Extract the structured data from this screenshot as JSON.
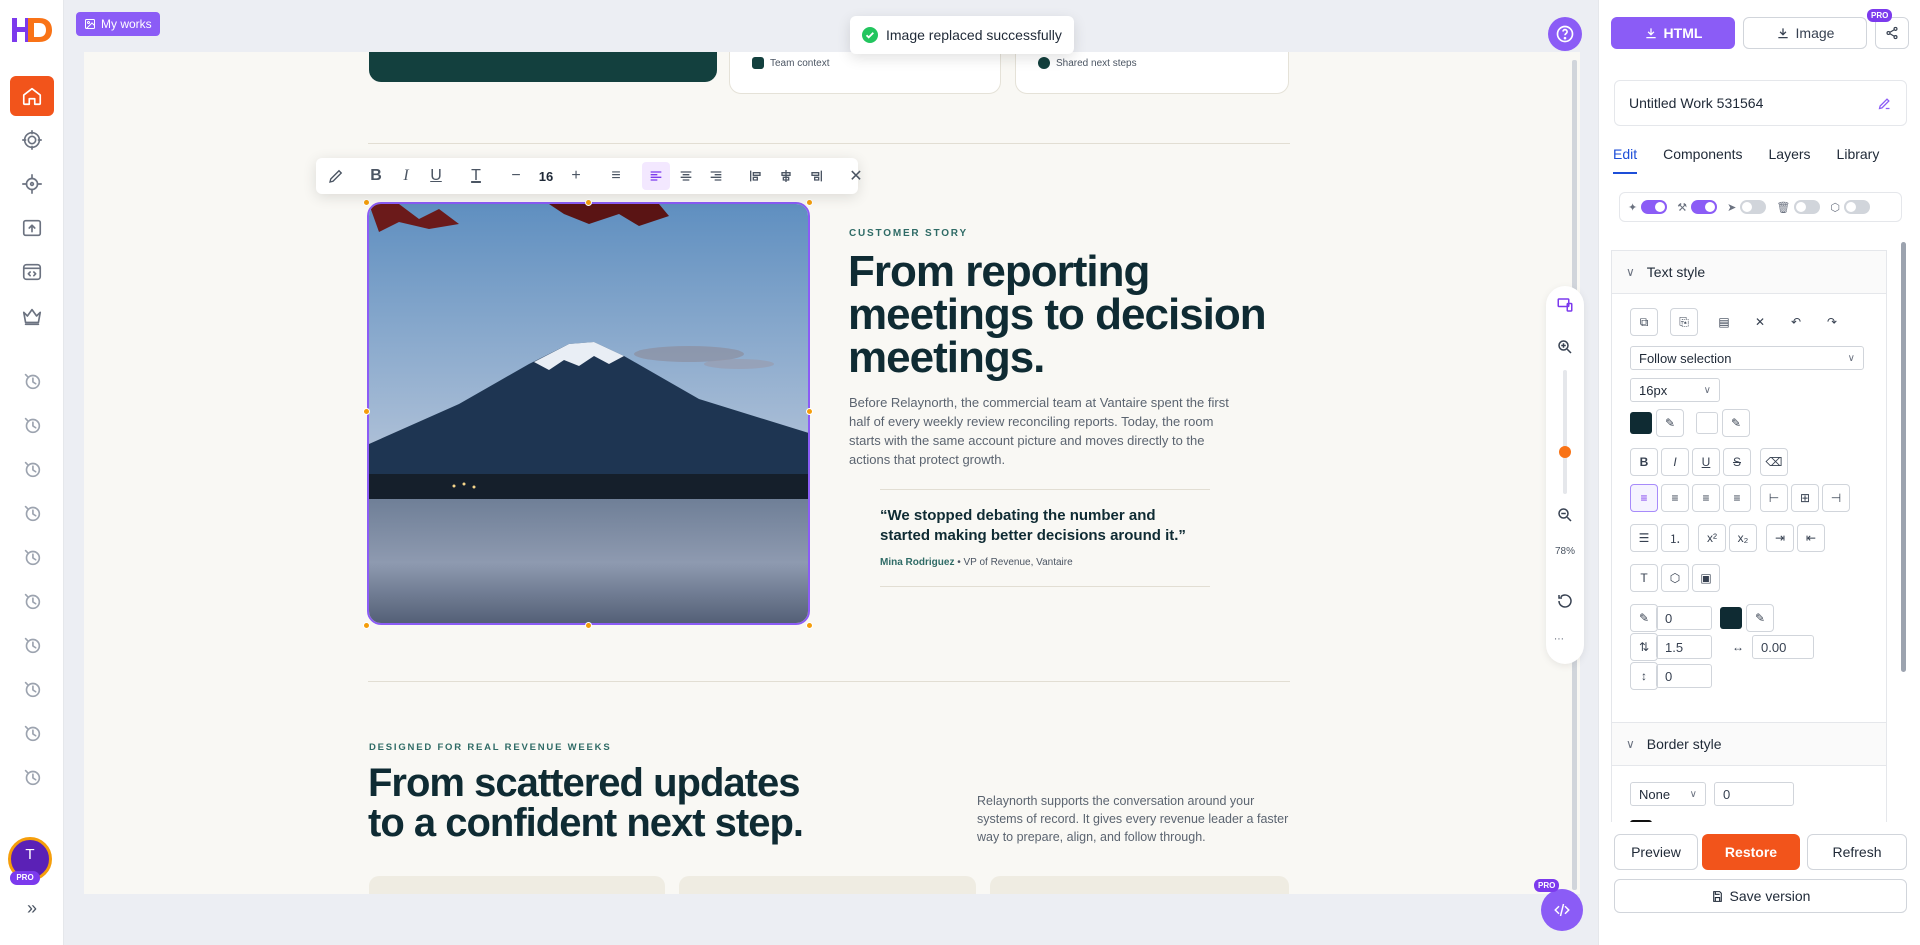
{
  "app": {
    "name": "HD"
  },
  "sidebar": {
    "items": [
      {
        "icon": "home-icon"
      },
      {
        "icon": "target-icon"
      },
      {
        "icon": "crosshair-icon"
      },
      {
        "icon": "upload-icon"
      },
      {
        "icon": "code-window-icon"
      },
      {
        "icon": "crown-icon"
      }
    ],
    "history_icon": "history-icon",
    "history_count": 10,
    "avatar": {
      "initial": "T",
      "badge": "PRO"
    },
    "expand_icon": "»"
  },
  "topbar": {
    "my_works_label": "My works",
    "toast": "Image replaced successfully",
    "help_icon": "help-icon"
  },
  "text_toolbar": {
    "font_size": "16",
    "minus": "−",
    "plus": "+"
  },
  "canvas_content": {
    "top_cards": [
      {
        "text": "Team context"
      },
      {
        "text": "Shared next steps"
      }
    ],
    "story": {
      "eyebrow": "CUSTOMER STORY",
      "title": "From reporting meetings to decision meetings.",
      "body": "Before Relaynorth, the commercial team at Vantaire spent the first half of every weekly review reconciling reports. Today, the room starts with the same account picture and moves directly to the actions that protect growth.",
      "quote": "“We stopped debating the number and started making better decisions around it.”",
      "attribution_name": "Mina Rodriguez",
      "attribution_role": " • VP of Revenue, Vantaire"
    },
    "section2": {
      "eyebrow": "DESIGNED FOR REAL REVENUE WEEKS",
      "title": "From scattered updates to a confident next step.",
      "body": "Relaynorth supports the conversation around your systems of record. It gives every revenue leader a faster way to prepare, align, and follow through."
    }
  },
  "zoom": {
    "level": "78%"
  },
  "right_panel": {
    "export_html": "HTML",
    "export_image": "Image",
    "pro_badge": "PRO",
    "work_title": "Untitled Work 531564",
    "tabs": [
      "Edit",
      "Components",
      "Layers",
      "Library"
    ],
    "active_tab": "Edit",
    "toggles": [
      true,
      true,
      false,
      false,
      false
    ],
    "text_style": {
      "heading": "Text style",
      "font_family": "Follow selection",
      "font_size": "16px",
      "text_color": "#0f2b33",
      "bg_color": "#ffffff",
      "stroke_width": "0",
      "stroke_color": "#0f2b33",
      "line_height": "1.5",
      "letter_spacing": "0.00",
      "paragraph_spacing": "0"
    },
    "border_style": {
      "heading": "Border style",
      "style": "None",
      "width": "0"
    },
    "footer": {
      "preview": "Preview",
      "restore": "Restore",
      "refresh": "Refresh",
      "save_version": "Save version"
    }
  },
  "colors": {
    "accent": "#8b5cf6",
    "orange": "#f2541b",
    "teal_dark": "#0f2b33",
    "success": "#22c55e"
  }
}
